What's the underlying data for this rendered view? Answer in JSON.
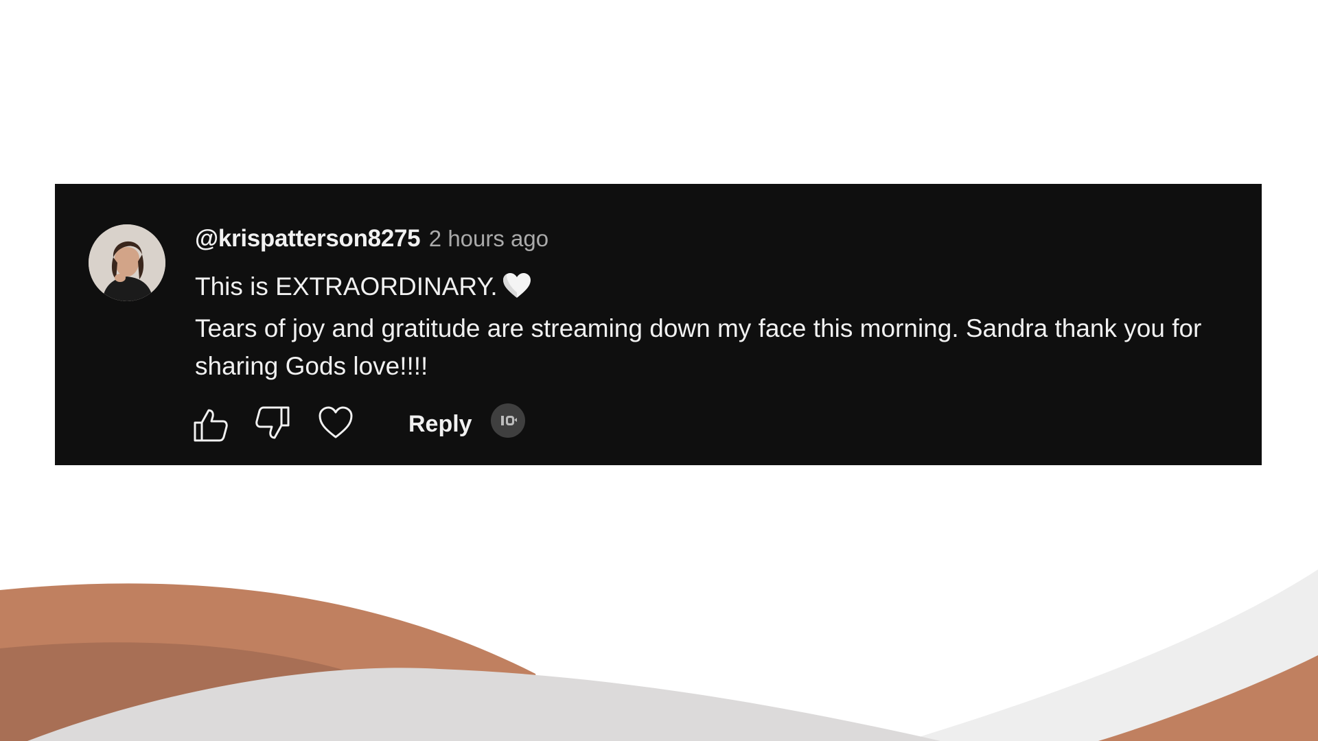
{
  "comment": {
    "author": "@krispatterson8275",
    "timestamp": "2 hours ago",
    "lines": [
      "This is EXTRAORDINARY.",
      "Tears of joy and gratitude are streaming down my face this morning. Sandra thank you for sharing Gods love!!!!"
    ],
    "emoji": "white-heart-icon",
    "avatar": "avatar"
  },
  "actions": {
    "like_icon": "thumbs-up-icon",
    "dislike_icon": "thumbs-down-icon",
    "heart_icon": "heart-icon",
    "reply_label": "Reply",
    "creator_badge_icon": "creator-avatar-icon"
  },
  "colors": {
    "card_background": "#0f0f0f",
    "text_primary": "#f1f1f1",
    "text_secondary": "#aaaaaa",
    "wave_orange": "#c08060",
    "wave_brown": "#a86f55",
    "wave_grey": "#dcdada"
  }
}
